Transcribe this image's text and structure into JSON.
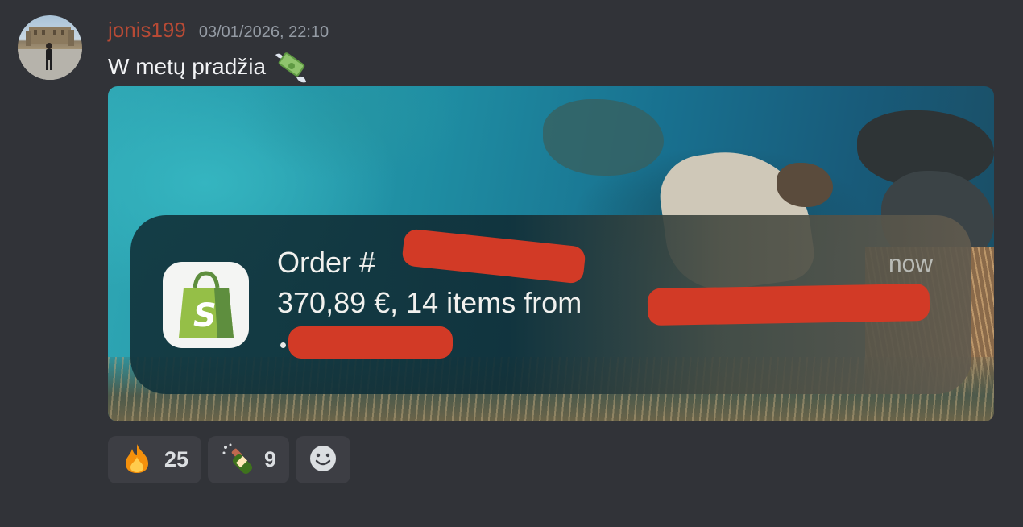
{
  "message": {
    "author": "jonis199",
    "timestamp": "03/01/2026, 22:10",
    "text": "W metų pradžia",
    "text_emoji_icon": "money-with-wings-icon",
    "author_color": "#b74a35"
  },
  "attachment": {
    "notification": {
      "app_icon": "shopify-bag-icon",
      "title": "Order #",
      "time": "now",
      "body": "370,89 €, 14 items from"
    }
  },
  "reactions": [
    {
      "icon": "fire-icon",
      "count": "25"
    },
    {
      "icon": "champagne-bottle-icon",
      "count": "9"
    }
  ],
  "add_reaction_icon": "smiley-add-reaction-icon",
  "colors": {
    "background": "#313338",
    "reaction_bg": "#3d3e44",
    "redaction": "#d23a26"
  }
}
